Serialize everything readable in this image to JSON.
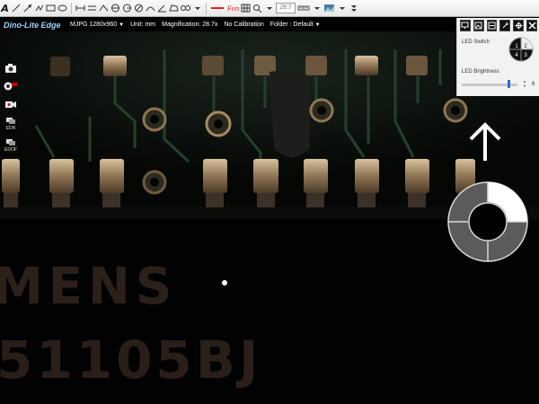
{
  "toolbar": {
    "text_tool_letter": "A",
    "zoom_value": "28.7"
  },
  "infobar": {
    "brand": "Dino-Lite Edge",
    "resolution": "MJPG 1280x960",
    "unit": "Unit: mm",
    "magnification": "Magnification: 28.7x",
    "calibration": "No Calibration",
    "folder": "Folder : Default"
  },
  "left_tools": {
    "edr_label": "EDR",
    "edof_label": "EDOF"
  },
  "led_panel": {
    "switch_label": "LED Switch",
    "brightness_label": "LED Brightness",
    "brightness_value": "6",
    "quadrant_labels": [
      "1",
      "2",
      "3",
      "4"
    ]
  },
  "specimen": {
    "text_line1": "MENS",
    "text_line2": "51105BJ"
  },
  "colors": {
    "accent_blue": "#9ad6ff",
    "slider_thumb": "#2a6bd6",
    "pcb_dark": "#0b0f0b",
    "pad_gold": "#a08a66"
  }
}
